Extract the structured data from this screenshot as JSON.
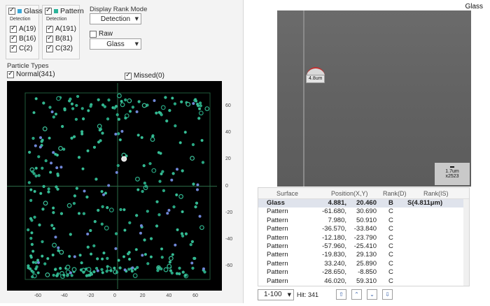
{
  "detection_groups": [
    {
      "name": "Glass",
      "color": "#3aa8d8",
      "detection_label": "Detection",
      "items": [
        {
          "label": "A(19)"
        },
        {
          "label": "B(16)"
        },
        {
          "label": "C(2)"
        }
      ]
    },
    {
      "name": "Pattern",
      "color": "#2bb39a",
      "detection_label": "Detection",
      "items": [
        {
          "label": "A(191)"
        },
        {
          "label": "B(81)"
        },
        {
          "label": "C(32)"
        }
      ]
    }
  ],
  "display_rank": {
    "label": "Display Rank Mode",
    "value": "Detection"
  },
  "raw": {
    "label": "Raw",
    "value": "Glass"
  },
  "particle_types": {
    "label": "Particle Types",
    "normal": "Normal(341)",
    "missed": "Missed(0)"
  },
  "chart_data": {
    "type": "scatter",
    "xlim": [
      -70,
      70
    ],
    "ylim": [
      -70,
      70
    ],
    "x_ticks": [
      -60,
      -40,
      -20,
      0,
      20,
      40,
      60
    ],
    "y_ticks": [
      60,
      40,
      20,
      0,
      -20,
      -40,
      -60
    ],
    "grid": "crosshair at 0,0 with dark green border",
    "series": [
      {
        "color": "#2fb58e",
        "count": 341
      },
      {
        "color": "#6f86d6"
      }
    ]
  },
  "image": {
    "title": "Glass",
    "defect_label": "4.8um",
    "scale_label": "1.7um",
    "magnification": "x2523"
  },
  "table": {
    "columns": [
      "Surface",
      "Position(X,Y)",
      "Rank(D)",
      "Rank(IS)"
    ],
    "rows": [
      {
        "surface": "Glass",
        "x": "4.881,",
        "y": "20.460",
        "rank_d": "B",
        "rank_is": "S(4.811μm)",
        "selected": true
      },
      {
        "surface": "Pattern",
        "x": "-61.680,",
        "y": "30.690",
        "rank_d": "C",
        "rank_is": ""
      },
      {
        "surface": "Pattern",
        "x": "7.980,",
        "y": "50.910",
        "rank_d": "C",
        "rank_is": ""
      },
      {
        "surface": "Pattern",
        "x": "-36.570,",
        "y": "-33.840",
        "rank_d": "C",
        "rank_is": ""
      },
      {
        "surface": "Pattern",
        "x": "-12.180,",
        "y": "-23.790",
        "rank_d": "C",
        "rank_is": ""
      },
      {
        "surface": "Pattern",
        "x": "-57.960,",
        "y": "-25.410",
        "rank_d": "C",
        "rank_is": ""
      },
      {
        "surface": "Pattern",
        "x": "-19.830,",
        "y": "29.130",
        "rank_d": "C",
        "rank_is": ""
      },
      {
        "surface": "Pattern",
        "x": "33.240,",
        "y": "25.890",
        "rank_d": "C",
        "rank_is": ""
      },
      {
        "surface": "Pattern",
        "x": "-28.650,",
        "y": "-8.850",
        "rank_d": "C",
        "rank_is": ""
      },
      {
        "surface": "Pattern",
        "x": "46.020,",
        "y": "59.310",
        "rank_d": "C",
        "rank_is": ""
      }
    ]
  },
  "pager": {
    "range": "1-100",
    "hit": "Hit: 341",
    "buttons": [
      "first",
      "prev",
      "next",
      "last"
    ]
  }
}
